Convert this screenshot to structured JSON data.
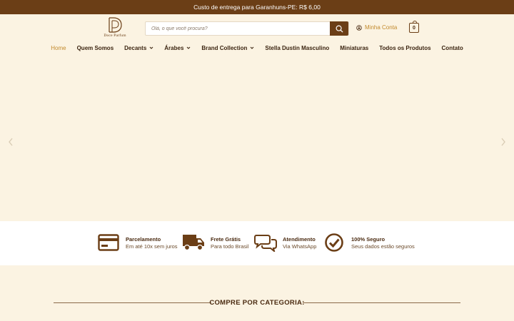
{
  "topbar": {
    "text": "Custo de entrega para Garanhuns-PE: R$ 6,00"
  },
  "logo": {
    "text": "Doce Parfum"
  },
  "search": {
    "placeholder": "Olá, o que você procura?"
  },
  "account": {
    "label": "Minha Conta"
  },
  "cart": {
    "count": "0"
  },
  "nav": {
    "items": [
      {
        "label": "Home",
        "active": true,
        "dropdown": false
      },
      {
        "label": "Quem Somos",
        "dropdown": false
      },
      {
        "label": "Decants",
        "dropdown": true
      },
      {
        "label": "Árabes",
        "dropdown": true
      },
      {
        "label": "Brand Collection",
        "dropdown": true
      },
      {
        "label": "Stella Dustin Masculino",
        "dropdown": false
      },
      {
        "label": "Miniaturas",
        "dropdown": false
      },
      {
        "label": "Todos os Produtos",
        "dropdown": false
      },
      {
        "label": "Contato",
        "dropdown": false
      }
    ]
  },
  "features": [
    {
      "title": "Parcelamento",
      "subtitle": "Em até 10x sem juros",
      "icon": "credit-card-icon"
    },
    {
      "title": "Frete Grátis",
      "subtitle": "Para todo Brasil",
      "icon": "truck-icon"
    },
    {
      "title": "Atendimento",
      "subtitle": "Via WhatsApp",
      "icon": "chat-bubbles-icon"
    },
    {
      "title": "100% Seguro",
      "subtitle": "Seus dados estão seguros",
      "icon": "check-circle-icon"
    }
  ],
  "category": {
    "title": "COMPRE POR CATEGORIA:"
  },
  "colors": {
    "brand": "#6b3e16",
    "accent": "#c28a2c",
    "background": "#fbf3e2"
  }
}
